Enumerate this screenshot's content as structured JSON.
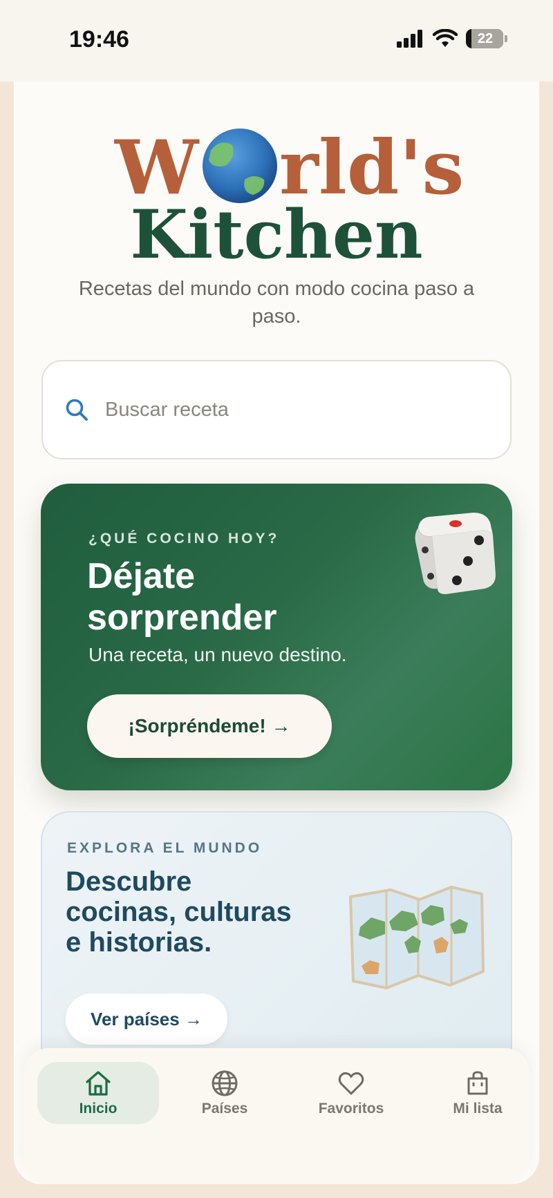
{
  "status_bar": {
    "time": "19:46",
    "battery": "22"
  },
  "logo": {
    "line1_prefix": "W",
    "line1_suffix": "rld's",
    "line2": "Kitchen"
  },
  "subtitle": "Recetas del mundo con modo cocina paso a paso.",
  "search": {
    "placeholder": "Buscar receta"
  },
  "surprise_card": {
    "eyebrow": "¿QUÉ COCINO HOY?",
    "title": "Déjate sorprender",
    "description": "Una receta, un nuevo destino.",
    "button_label": "¡Sorpréndeme! →"
  },
  "explore_card": {
    "eyebrow": "EXPLORA EL MUNDO",
    "title": "Descubre cocinas, culturas e historias.",
    "button_label": "Ver países →"
  },
  "tabbar": {
    "tabs": [
      {
        "label": "Inicio",
        "icon": "home-icon",
        "active": true
      },
      {
        "label": "Países",
        "icon": "globe-icon",
        "active": false
      },
      {
        "label": "Favoritos",
        "icon": "heart-icon",
        "active": false
      },
      {
        "label": "Mi lista",
        "icon": "shopping-bag-icon",
        "active": false
      }
    ]
  },
  "colors": {
    "brand_orange": "#b5603a",
    "brand_green": "#1e5238",
    "card_green": "#2a6a47",
    "explore_blue": "#1f4a60",
    "active_tab": "#1f6b45"
  }
}
